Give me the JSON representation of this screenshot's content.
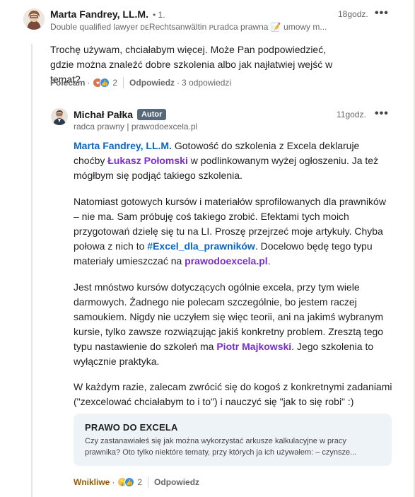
{
  "comment1": {
    "author": "Marta Fandrey, LL.M.",
    "degree": "• 1.",
    "headline": "Double qualified lawyer ᴅᴇRechtsanwältin ᴘʟradca prawna 📝 umowy m...",
    "time": "18godz.",
    "more": "•••",
    "text": "Trochę używam, chciałabym więcej. Może Pan podpowiedzieć, gdzie można znaleźć dobre szkolenia albo jak najłatwiej wejść w temat?",
    "actions": {
      "like_label": "Polecam",
      "reaction_count": "2",
      "reply_label": "Odpowiedz",
      "replies_count": "3 odpowiedzi",
      "dot": "·"
    }
  },
  "comment2": {
    "author": "Michał Pałka",
    "badge": "Autor",
    "headline": "radca prawny | prawodoexcela.pl",
    "time": "11godz.",
    "more": "•••",
    "p1": {
      "mention1": "Marta Fandrey, LL.M.",
      "t1": " Gotowość do szkolenia z Excela deklaruje choćby ",
      "mention2": "Łukasz Połomski",
      "t2": " w podlinkowanym wyżej ogłoszeniu. Ja też mógłbym się podjąć takiego szkolenia."
    },
    "p2": {
      "t1": "Natomiast gotowych kursów i materiałów sprofilowanych dla prawników – nie ma. Sam próbuję coś takiego zrobić. Efektami tych moich przygotowań dzielę się tu na LI. Proszę przejrzeć moje artykuły. Chyba połowa z nich to ",
      "hashtag": "#Excel_dla_prawników",
      "t2": ". Docelowo będę tego typu materiały umieszczać na ",
      "link": "prawodoexcela.pl",
      "t3": "."
    },
    "p3": {
      "t1": "Jest mnóstwo kursów dotyczących ogólnie excela, przy tym wiele darmowych. Żadnego nie polecam szczególnie, bo jestem raczej samoukiem. Nigdy nie uczyłem się więc teorii, ani na jakimś wybranym kursie, tylko zawsze rozwiązując jakiś konkretny problem. Zresztą tego typu nastawienie do szkoleń ma ",
      "mention": "Piotr Majkowski",
      "t2": ". Jego szkolenia to wyłącznie praktyka."
    },
    "p4": "W każdym razie, zalecam zwrócić się do kogoś z konkretnymi zadaniami (\"zexcelować chciałabym to i to\") i nauczyć się \"jak to się robi\" :)",
    "card": {
      "title": "PRAWO DO EXCELA",
      "text": "Czy zastanawiałeś się jak można wykorzystać arkusze kalkulacyjne w pracy prawnika? Oto tylko niektóre tematy, przy których ja ich używałem: – czynsze..."
    },
    "actions": {
      "like_label": "Wnikliwe",
      "reaction_count": "2",
      "reply_label": "Odpowiedz",
      "dot": "·"
    }
  },
  "colors": {
    "link_blue": "#0a66c2",
    "link_purple": "#7b2ecf",
    "insightful": "#915907",
    "badge_bg": "#56687a"
  }
}
